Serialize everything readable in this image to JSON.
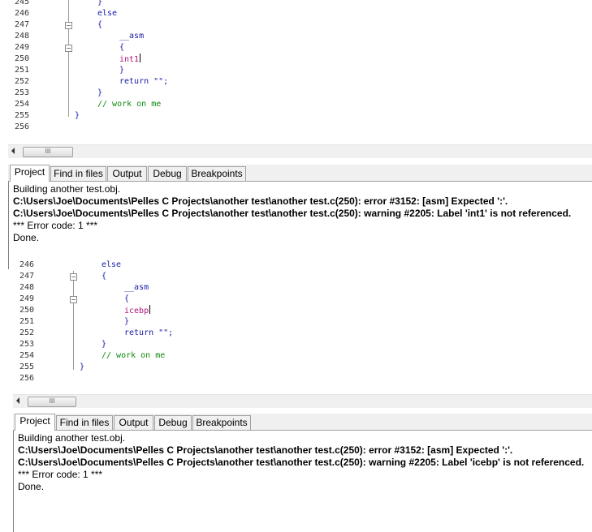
{
  "top": {
    "editor": {
      "lines": [
        {
          "n": "245",
          "t": "}",
          "cls": "kw"
        },
        {
          "n": "246",
          "t": "else",
          "cls": "kw"
        },
        {
          "n": "247",
          "t": "{",
          "cls": "kw"
        },
        {
          "n": "248",
          "t": "__asm",
          "cls": "asm"
        },
        {
          "n": "249",
          "t": "{",
          "cls": "kw"
        },
        {
          "n": "250",
          "t": "int1",
          "cls": "mnem"
        },
        {
          "n": "251",
          "t": "}",
          "cls": "kw"
        },
        {
          "n": "252",
          "t": "return \"\";",
          "cls": "kw"
        },
        {
          "n": "253",
          "t": "}",
          "cls": "kw"
        },
        {
          "n": "254",
          "t": "// work on me",
          "cls": "cmt"
        },
        {
          "n": "255",
          "t": "}",
          "cls": "kw"
        },
        {
          "n": "256",
          "t": "",
          "cls": "kw"
        }
      ]
    },
    "scroll_thumb": "III",
    "tabs": [
      "Project",
      "Find in files",
      "Output",
      "Debug",
      "Breakpoints"
    ],
    "output": [
      "Building another test.obj.",
      "C:\\Users\\Joe\\Documents\\Pelles C Projects\\another test\\another test.c(250): error #3152: [asm] Expected ':'.",
      "C:\\Users\\Joe\\Documents\\Pelles C Projects\\another test\\another test.c(250): warning #2205: Label 'int1' is not referenced.",
      "*** Error code: 1 ***",
      "Done."
    ]
  },
  "bottom": {
    "editor": {
      "lines": [
        {
          "n": "246",
          "t": "else",
          "cls": "kw"
        },
        {
          "n": "247",
          "t": "{",
          "cls": "kw"
        },
        {
          "n": "248",
          "t": "__asm",
          "cls": "asm"
        },
        {
          "n": "249",
          "t": "{",
          "cls": "kw"
        },
        {
          "n": "250",
          "t": "icebp",
          "cls": "mnem"
        },
        {
          "n": "251",
          "t": "}",
          "cls": "kw"
        },
        {
          "n": "252",
          "t": "return \"\";",
          "cls": "kw"
        },
        {
          "n": "253",
          "t": "}",
          "cls": "kw"
        },
        {
          "n": "254",
          "t": "// work on me",
          "cls": "cmt"
        },
        {
          "n": "255",
          "t": "}",
          "cls": "kw"
        },
        {
          "n": "256",
          "t": "",
          "cls": "kw"
        }
      ]
    },
    "scroll_thumb": "III",
    "tabs": [
      "Project",
      "Find in files",
      "Output",
      "Debug",
      "Breakpoints"
    ],
    "output": [
      "Building another test.obj.",
      "C:\\Users\\Joe\\Documents\\Pelles C Projects\\another test\\another test.c(250): error #3152: [asm] Expected ':'.",
      "C:\\Users\\Joe\\Documents\\Pelles C Projects\\another test\\another test.c(250): warning #2205: Label 'icebp' is not referenced.",
      "*** Error code: 1 ***",
      "Done."
    ]
  },
  "fold_glyph": "−"
}
